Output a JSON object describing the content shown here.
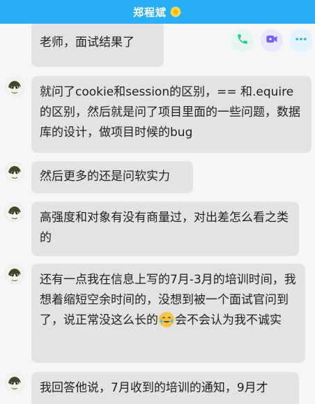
{
  "window": {
    "title": "郑程斌",
    "badge_icon": "star-icon"
  },
  "toolbar": {
    "buttons": [
      {
        "icon": "phone-icon",
        "color": "#20c997"
      },
      {
        "icon": "video-icon",
        "color": "#7b5cff"
      },
      {
        "icon": "more-icon",
        "color": "#1a9cf0"
      }
    ]
  },
  "messages": [
    {
      "text": "老师，面试结果了"
    },
    {
      "text": "就问了cookie和session的区别，== 和.equire的区别，然后就是问了项目里面的一些问题，数据库的设计，做项目时候的bug"
    },
    {
      "text": "然后更多的还是问软实力"
    },
    {
      "text": "高强度和对象有没有商量过，对出差怎么看之类的"
    },
    {
      "text_before": "还有一点我在信息上写的7月-3月的培训时间，我想着缩短空余时间的，没想到被一个面试官问到了，说正常没这么长的",
      "emoji": "tears-of-joy-icon",
      "text_after": "会不会认为我不诚实"
    },
    {
      "text": "我回答他说，7月收到的培训的通知，9月才"
    }
  ]
}
